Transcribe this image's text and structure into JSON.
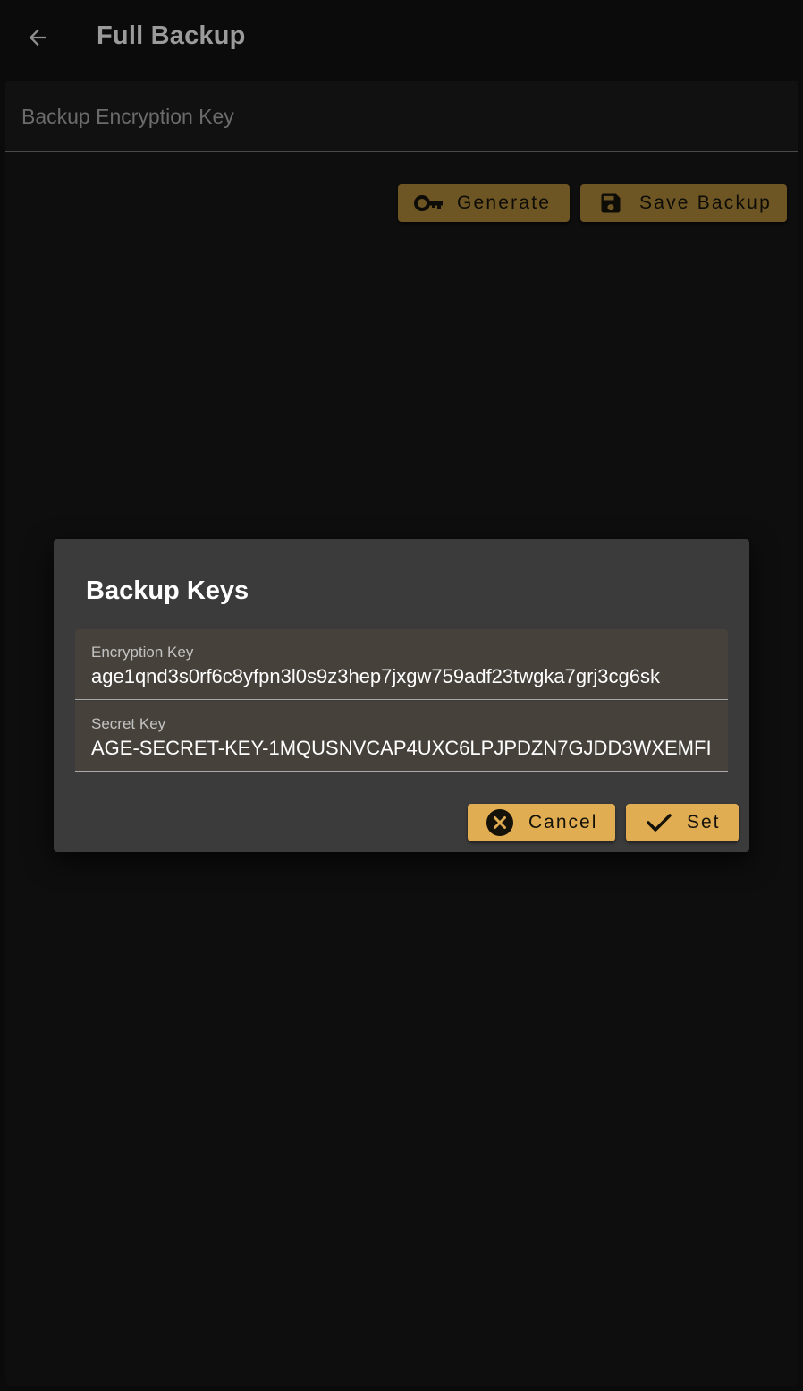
{
  "app_bar": {
    "title": "Full Backup"
  },
  "main": {
    "encryption_key_field": {
      "label": "Backup Encryption Key"
    },
    "buttons": {
      "generate": "Generate",
      "save_backup": "Save Backup"
    }
  },
  "dialog": {
    "title": "Backup Keys",
    "encryption_key": {
      "label": "Encryption Key",
      "value": "age1qnd3s0rf6c8yfpn3l0s9z3hep7jxgw759adf23twgka7grj3cg6sk"
    },
    "secret_key": {
      "label": "Secret Key",
      "value": "AGE-SECRET-KEY-1MQUSNVCAP4UXC6LPJPDZN7GJDD3WXEMFI"
    },
    "buttons": {
      "cancel": "Cancel",
      "set": "Set"
    }
  },
  "icons": {
    "back": "arrow-left-icon",
    "generate": "key-icon",
    "save": "floppy-disk-icon",
    "cancel": "close-circle-icon",
    "set": "check-icon"
  },
  "colors": {
    "background": "#0b0b0b",
    "dialog": "#3b3b3b",
    "accent": "#e0ad52",
    "accent_dimmed": "#6d5524"
  }
}
